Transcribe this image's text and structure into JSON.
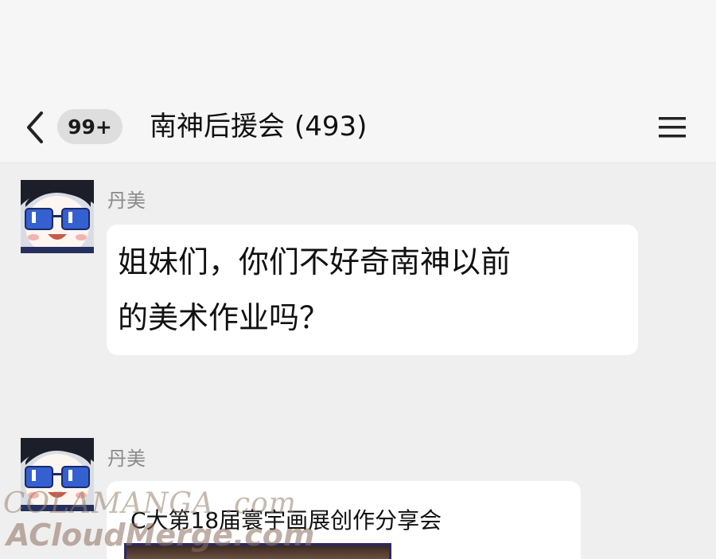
{
  "header": {
    "back_icon": "chevron-left-icon",
    "unread_badge": "99+",
    "group_name": "南神后援会",
    "member_count": "(493)",
    "menu_icon": "hamburger-menu-icon"
  },
  "messages": [
    {
      "sender": "丹美",
      "text_line1": "姐妹们，你们不好奇南神以前",
      "text_line2": "的美术作业吗？"
    },
    {
      "sender": "丹美",
      "card_title": "C大第18届寰宇画展创作分享会"
    }
  ],
  "watermark": {
    "line1": "COLAMANGA .com",
    "line2": "ACloudMerge.com"
  },
  "colors": {
    "background": "#efefef",
    "header_bg": "#f6f6f6",
    "bubble_bg": "#ffffff",
    "badge_bg": "#dedede",
    "avatar_glasses": "#2f55c8"
  }
}
